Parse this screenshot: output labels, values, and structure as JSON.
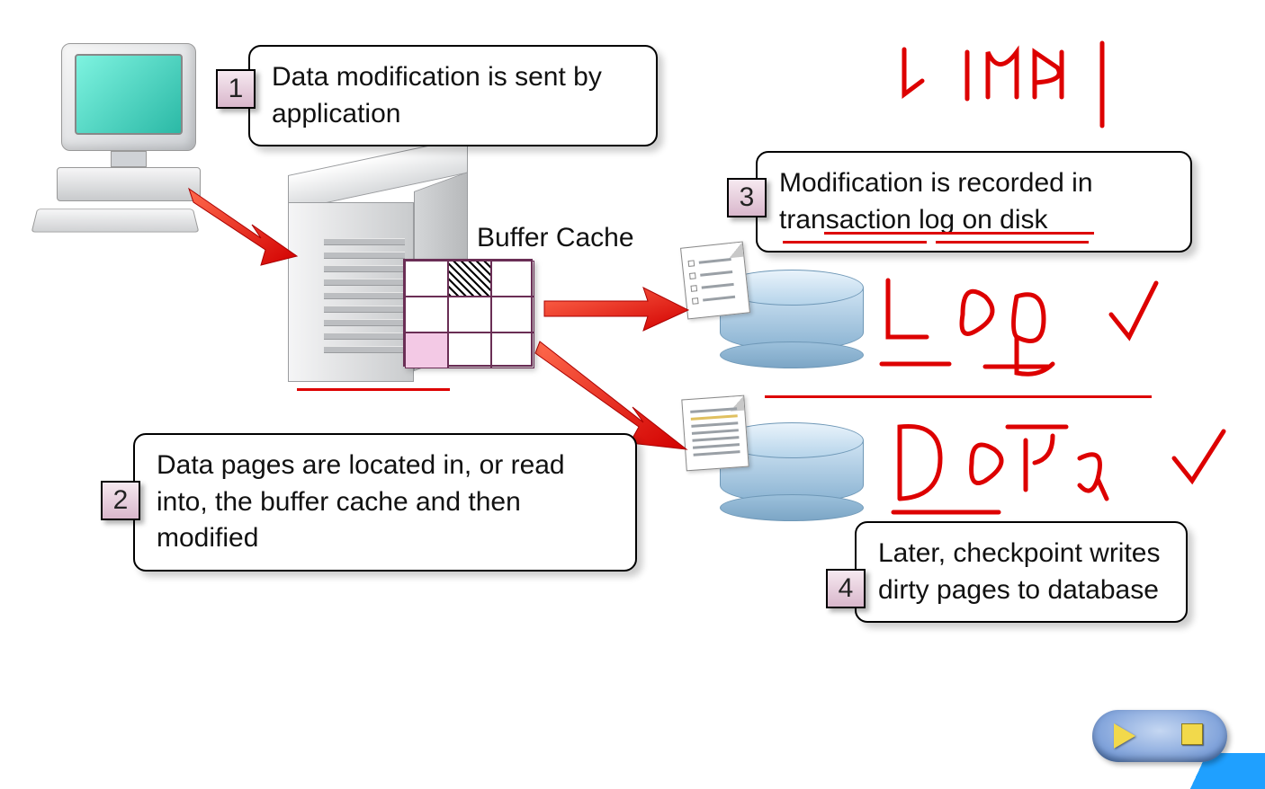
{
  "diagram": {
    "buffer_cache_label": "Buffer Cache",
    "steps": [
      {
        "num": "1",
        "text": "Data modification is sent by application"
      },
      {
        "num": "2",
        "text": "Data pages are located in, or read into, the buffer cache and then modified"
      },
      {
        "num": "3",
        "text": "Modification is recorded in transaction log on disk"
      },
      {
        "num": "4",
        "text": "Later, checkpoint writes dirty pages to database"
      }
    ],
    "icons": {
      "computer": "computer-icon",
      "server": "server-icon",
      "log_disk": "disk-log-icon",
      "data_disk": "disk-data-icon"
    },
    "annotations": {
      "top_right": "LUN 1",
      "mid_right": "Log ✓",
      "lower_right": "Data ✓"
    }
  },
  "controls": {
    "play_label": "Play",
    "stop_label": "Stop"
  }
}
